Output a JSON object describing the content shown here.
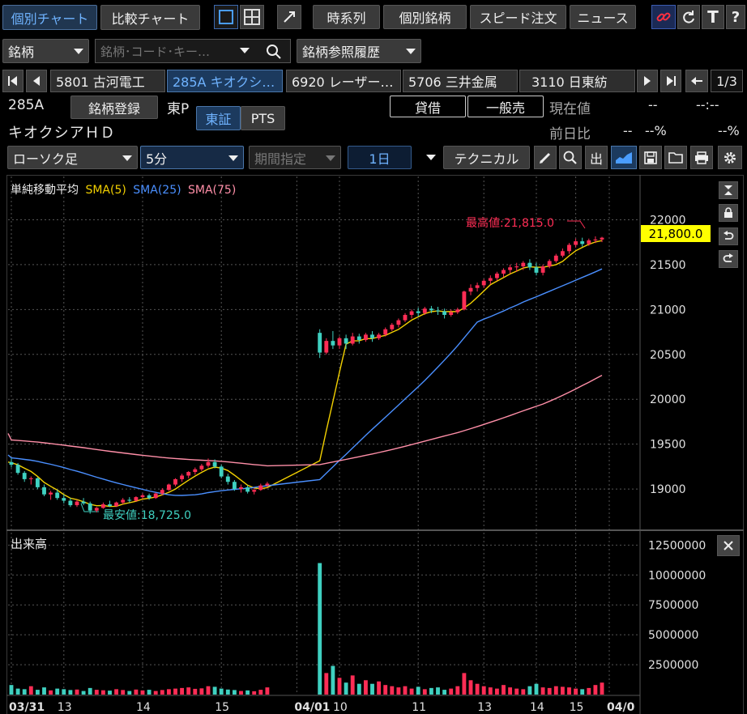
{
  "top_tabs": {
    "individual": "個別チャート",
    "compare": "比較チャート"
  },
  "top_buttons": {
    "timeseries": "時系列",
    "individual_stock": "個別銘柄",
    "speed_order": "スピード注文",
    "news": "ニュース"
  },
  "search": {
    "type_label": "銘柄",
    "placeholder": "銘柄･コード･キー…",
    "history_label": "銘柄参照履歴"
  },
  "stock_tabs": [
    {
      "label": "5801 古河電工"
    },
    {
      "label": "285A キオクシ…"
    },
    {
      "label": "6920 レーザー…"
    },
    {
      "label": "5706 三井金属"
    },
    {
      "label": "3110 日東紡"
    }
  ],
  "page_indicator": "1/3",
  "info": {
    "code": "285A",
    "register_label": "銘柄登録",
    "market": "東P",
    "name": "キオクシアＨＤ",
    "exchange_tse": "東証",
    "exchange_pts": "PTS",
    "margin_label": "貸借",
    "general_sell": "一般売",
    "current_price_label": "現在値",
    "current_price": "--",
    "current_time": "--:--",
    "change_label": "前日比",
    "change_value": "--",
    "change_pct": "--%",
    "change_pct2": "--%"
  },
  "controls": {
    "chart_type": "ローソク足",
    "interval": "5分",
    "period": "期間指定",
    "range": "1日",
    "technical": "テクニカル",
    "out_label": "出"
  },
  "legend": {
    "title": "単純移動平均",
    "sma5": "SMA(5)",
    "sma25": "SMA(25)",
    "sma75": "SMA(75)"
  },
  "colors": {
    "up": "#ff2d55",
    "down": "#3fd0c0",
    "sma5": "#f2d000",
    "sma25": "#4a8fff",
    "sma75": "#ff8fa8",
    "price_tag": "#ffff00"
  },
  "volume_title": "出来高",
  "chart_data": [
    {
      "type": "candlestick",
      "title": "",
      "y_ticks": [
        19000,
        19500,
        20000,
        20500,
        21000,
        21500,
        22000
      ],
      "ylim": [
        18550,
        22500
      ],
      "x_labels": [
        "03/31",
        "13",
        "14",
        "15",
        "04/01",
        "10",
        "11",
        "13",
        "14",
        "15",
        "04/0"
      ],
      "current_price_label": "21,800.0",
      "current_price": 21800,
      "high_annotation": "最高値:21,815.0",
      "high_value": 21815,
      "low_annotation": "最安値:18,725.0",
      "low_value": 18725,
      "ohlc": [
        [
          19300,
          19340,
          19240,
          19270
        ],
        [
          19270,
          19290,
          19160,
          19180
        ],
        [
          19180,
          19200,
          19080,
          19110
        ],
        [
          19110,
          19140,
          19050,
          19120
        ],
        [
          19120,
          19130,
          19000,
          19020
        ],
        [
          19020,
          19050,
          18920,
          18940
        ],
        [
          18940,
          18980,
          18880,
          18960
        ],
        [
          18960,
          18990,
          18880,
          18900
        ],
        [
          18900,
          18940,
          18840,
          18870
        ],
        [
          18870,
          18900,
          18800,
          18820
        ],
        [
          18820,
          18880,
          18800,
          18860
        ],
        [
          18860,
          18900,
          18820,
          18840
        ],
        [
          18840,
          18860,
          18725,
          18760
        ],
        [
          18760,
          18800,
          18740,
          18790
        ],
        [
          18790,
          18850,
          18780,
          18830
        ],
        [
          18830,
          18870,
          18800,
          18810
        ],
        [
          18810,
          18860,
          18800,
          18850
        ],
        [
          18850,
          18900,
          18830,
          18880
        ],
        [
          18880,
          18910,
          18850,
          18870
        ],
        [
          18870,
          18920,
          18860,
          18910
        ],
        [
          18910,
          18950,
          18890,
          18930
        ],
        [
          18930,
          18950,
          18880,
          18900
        ],
        [
          18900,
          18960,
          18890,
          18950
        ],
        [
          18950,
          19010,
          18930,
          18990
        ],
        [
          18990,
          19060,
          18980,
          19050
        ],
        [
          19050,
          19120,
          19030,
          19110
        ],
        [
          19110,
          19170,
          19080,
          19150
        ],
        [
          19150,
          19200,
          19120,
          19190
        ],
        [
          19190,
          19240,
          19160,
          19220
        ],
        [
          19220,
          19280,
          19200,
          19260
        ],
        [
          19260,
          19340,
          19240,
          19300
        ],
        [
          19300,
          19330,
          19230,
          19250
        ],
        [
          19250,
          19270,
          19120,
          19140
        ],
        [
          19140,
          19170,
          19050,
          19080
        ],
        [
          19080,
          19100,
          18980,
          19000
        ],
        [
          19000,
          19050,
          18960,
          19020
        ],
        [
          19020,
          19040,
          18950,
          18970
        ],
        [
          18970,
          19010,
          18940,
          18990
        ],
        [
          18990,
          19060,
          18980,
          19040
        ],
        [
          19040,
          19080,
          19020,
          19060
        ],
        [
          20740,
          20780,
          20460,
          20520
        ],
        [
          20520,
          20680,
          20500,
          20650
        ],
        [
          20650,
          20760,
          20560,
          20600
        ],
        [
          20600,
          20700,
          20560,
          20680
        ],
        [
          20680,
          20720,
          20560,
          20620
        ],
        [
          20620,
          20740,
          20600,
          20700
        ],
        [
          20700,
          20730,
          20620,
          20660
        ],
        [
          20660,
          20740,
          20640,
          20720
        ],
        [
          20720,
          20760,
          20640,
          20680
        ],
        [
          20680,
          20740,
          20660,
          20720
        ],
        [
          20720,
          20800,
          20700,
          20780
        ],
        [
          20780,
          20850,
          20760,
          20830
        ],
        [
          20830,
          20900,
          20800,
          20880
        ],
        [
          20880,
          20960,
          20860,
          20940
        ],
        [
          20940,
          21000,
          20900,
          20980
        ],
        [
          20980,
          21020,
          20920,
          20960
        ],
        [
          20960,
          21030,
          20940,
          21010
        ],
        [
          21010,
          21040,
          20960,
          20990
        ],
        [
          20990,
          21030,
          20940,
          20980
        ],
        [
          20980,
          21010,
          20900,
          20940
        ],
        [
          20940,
          21000,
          20920,
          20970
        ],
        [
          20970,
          21020,
          20950,
          21000
        ],
        [
          21000,
          21210,
          20990,
          21200
        ],
        [
          21200,
          21280,
          21160,
          21240
        ],
        [
          21240,
          21300,
          21200,
          21270
        ],
        [
          21270,
          21340,
          21240,
          21320
        ],
        [
          21320,
          21380,
          21280,
          21350
        ],
        [
          21350,
          21420,
          21320,
          21400
        ],
        [
          21400,
          21460,
          21360,
          21440
        ],
        [
          21440,
          21500,
          21400,
          21470
        ],
        [
          21470,
          21520,
          21420,
          21480
        ],
        [
          21480,
          21540,
          21440,
          21520
        ],
        [
          21520,
          21560,
          21440,
          21470
        ],
        [
          21470,
          21520,
          21380,
          21410
        ],
        [
          21410,
          21500,
          21380,
          21480
        ],
        [
          21480,
          21560,
          21460,
          21540
        ],
        [
          21540,
          21620,
          21520,
          21600
        ],
        [
          21600,
          21680,
          21580,
          21650
        ],
        [
          21650,
          21740,
          21620,
          21720
        ],
        [
          21720,
          21790,
          21690,
          21760
        ],
        [
          21760,
          21800,
          21700,
          21730
        ],
        [
          21730,
          21790,
          21710,
          21770
        ],
        [
          21770,
          21815,
          21740,
          21780
        ],
        [
          21780,
          21810,
          21750,
          21800
        ]
      ],
      "series": [
        {
          "name": "SMA(5)",
          "values": []
        },
        {
          "name": "SMA(25)",
          "values": []
        },
        {
          "name": "SMA(75)",
          "values": []
        }
      ]
    },
    {
      "type": "bar",
      "title": "",
      "y_ticks": [
        2500000,
        5000000,
        7500000,
        10000000,
        12500000
      ],
      "ylim": [
        0,
        13000000
      ],
      "volume": [
        800000,
        500000,
        450000,
        700000,
        400000,
        600000,
        350000,
        500000,
        450000,
        380000,
        420000,
        300000,
        550000,
        400000,
        360000,
        330000,
        450000,
        380000,
        300000,
        420000,
        350000,
        400000,
        300000,
        380000,
        450000,
        500000,
        550000,
        600000,
        480000,
        520000,
        700000,
        650000,
        500000,
        420000,
        380000,
        300000,
        350000,
        280000,
        400000,
        600000,
        11000000,
        1800000,
        2400000,
        1400000,
        1000000,
        1600000,
        900000,
        1200000,
        900000,
        1100000,
        800000,
        700000,
        600000,
        700000,
        500000,
        650000,
        450000,
        550000,
        600000,
        400000,
        500000,
        700000,
        1800000,
        1200000,
        900000,
        700000,
        600000,
        500000,
        800000,
        600000,
        500000,
        450000,
        700000,
        900000,
        600000,
        550000,
        700000,
        650000,
        600000,
        500000,
        450000,
        550000,
        800000,
        1000000
      ]
    }
  ]
}
